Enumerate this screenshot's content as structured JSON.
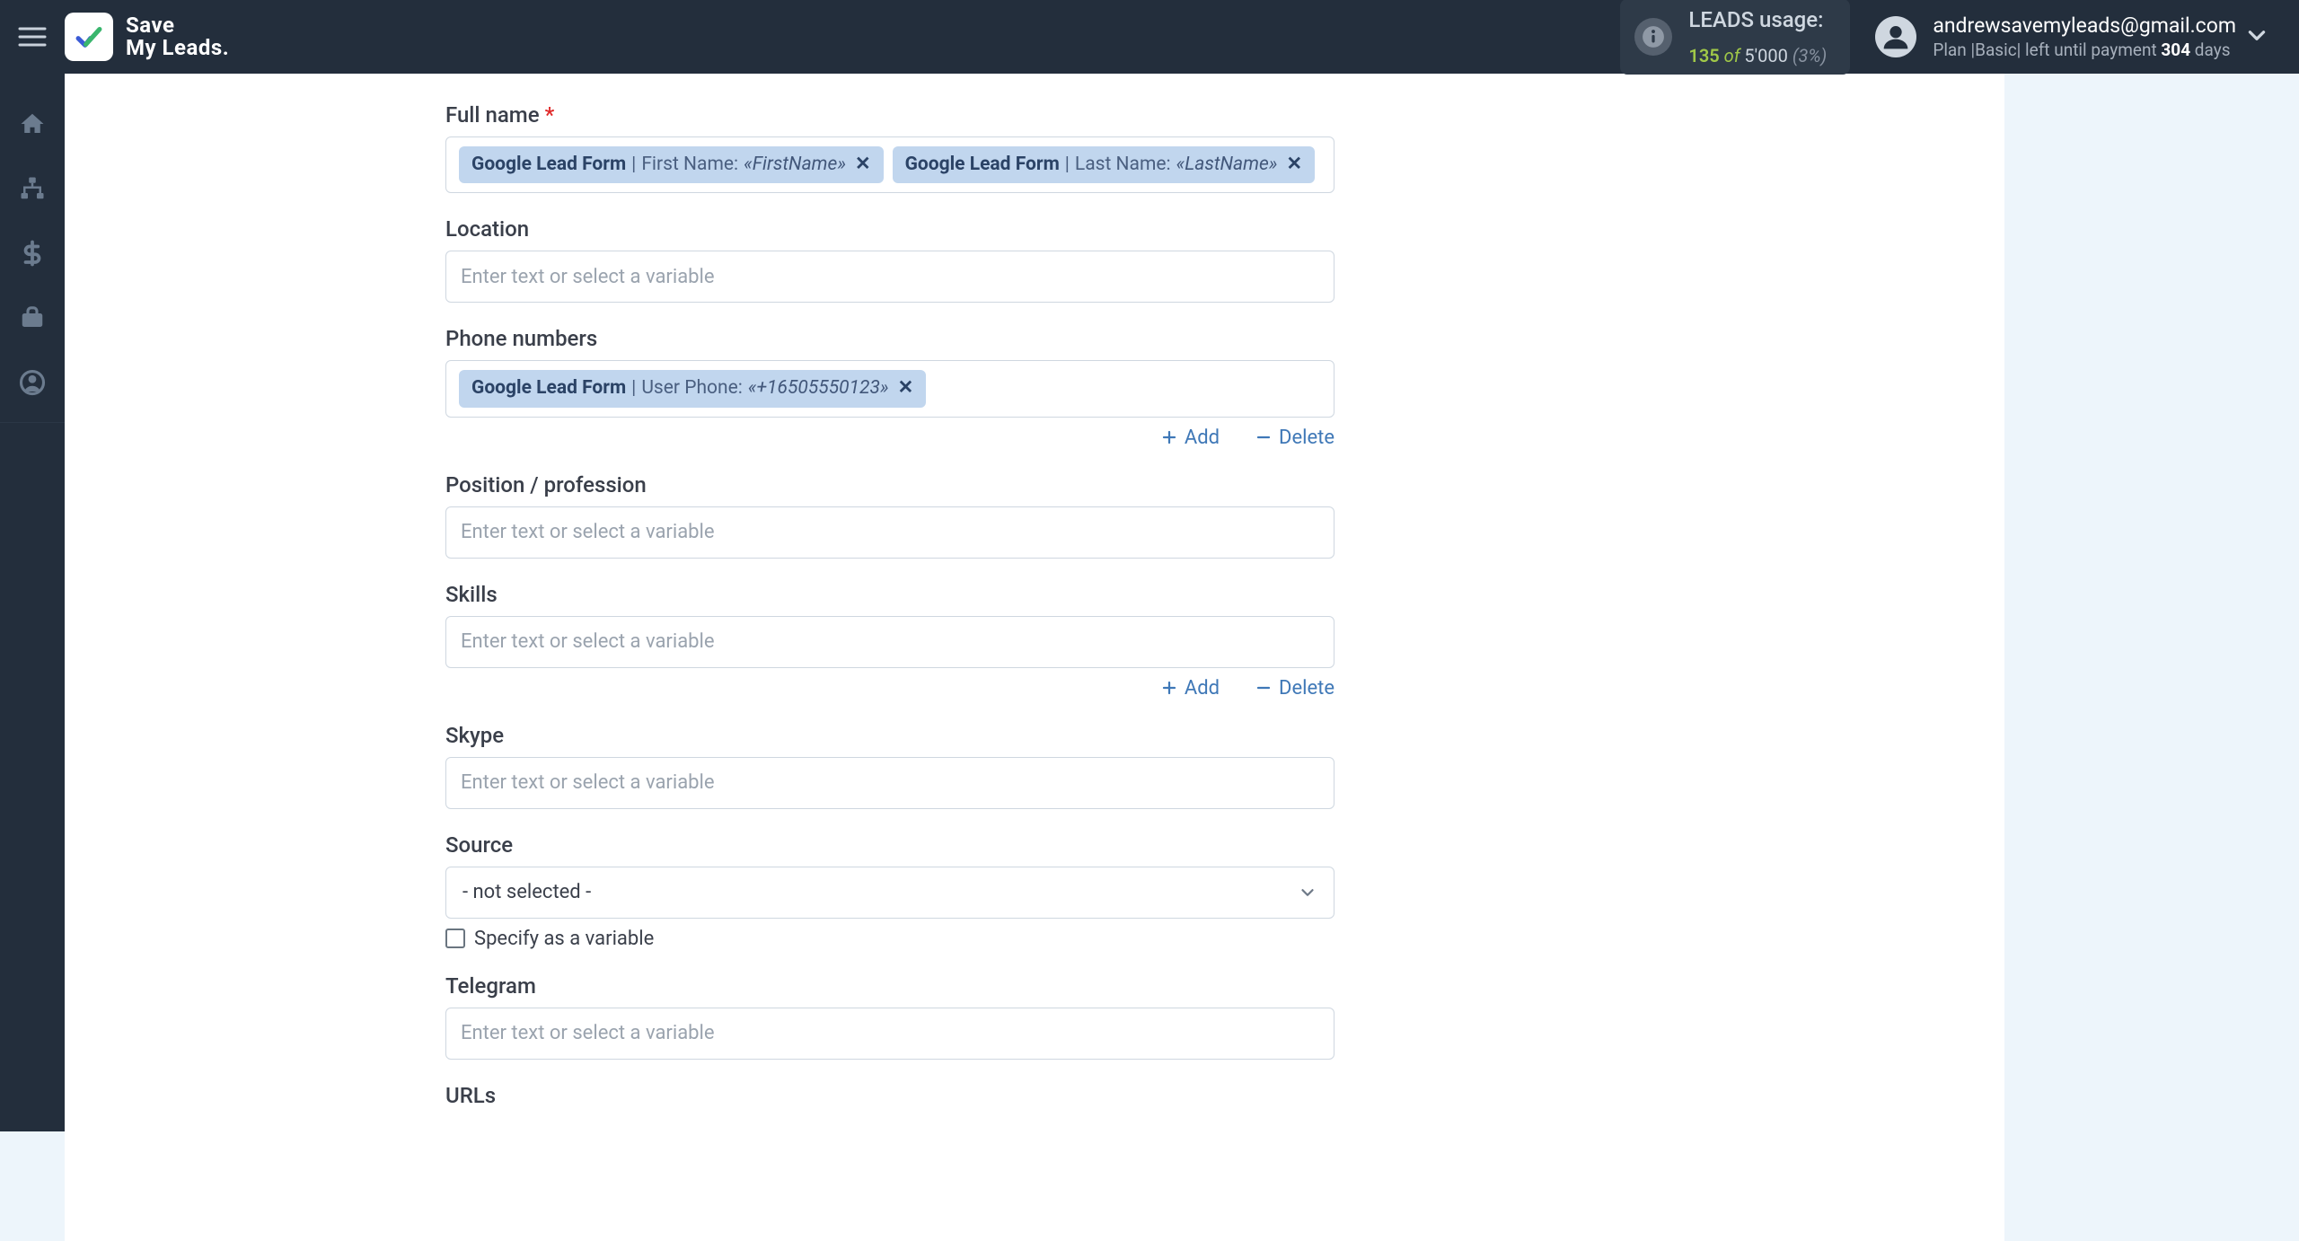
{
  "app": {
    "name_line1": "Save",
    "name_line2": "My Leads."
  },
  "usage": {
    "label": "LEADS usage:",
    "used": "135",
    "of_word": "of",
    "total": "5'000",
    "pct": "(3%)"
  },
  "account": {
    "email": "andrewsavemyleads@gmail.com",
    "plan_prefix": "Plan |Basic|  left until payment ",
    "days": "304",
    "days_suffix": " days"
  },
  "form": {
    "full_name": {
      "label": "Full name",
      "chip1": {
        "src": "Google Lead Form",
        "sep": " | ",
        "field": "First Name: ",
        "val": "«FirstName»"
      },
      "chip2": {
        "src": "Google Lead Form",
        "sep": " | ",
        "field": "Last Name: ",
        "val": "«LastName»"
      }
    },
    "location": {
      "label": "Location",
      "placeholder": "Enter text or select a variable"
    },
    "phone": {
      "label": "Phone numbers",
      "chip": {
        "src": "Google Lead Form",
        "sep": " | ",
        "field": "User Phone: ",
        "val": "«+16505550123»"
      }
    },
    "position": {
      "label": "Position / profession",
      "placeholder": "Enter text or select a variable"
    },
    "skills": {
      "label": "Skills",
      "placeholder": "Enter text or select a variable"
    },
    "skype": {
      "label": "Skype",
      "placeholder": "Enter text or select a variable"
    },
    "source": {
      "label": "Source",
      "selected": "- not selected -",
      "specify": "Specify as a variable"
    },
    "telegram": {
      "label": "Telegram",
      "placeholder": "Enter text or select a variable"
    },
    "urls": {
      "label": "URLs"
    },
    "actions": {
      "add": "Add",
      "delete": "Delete"
    }
  }
}
